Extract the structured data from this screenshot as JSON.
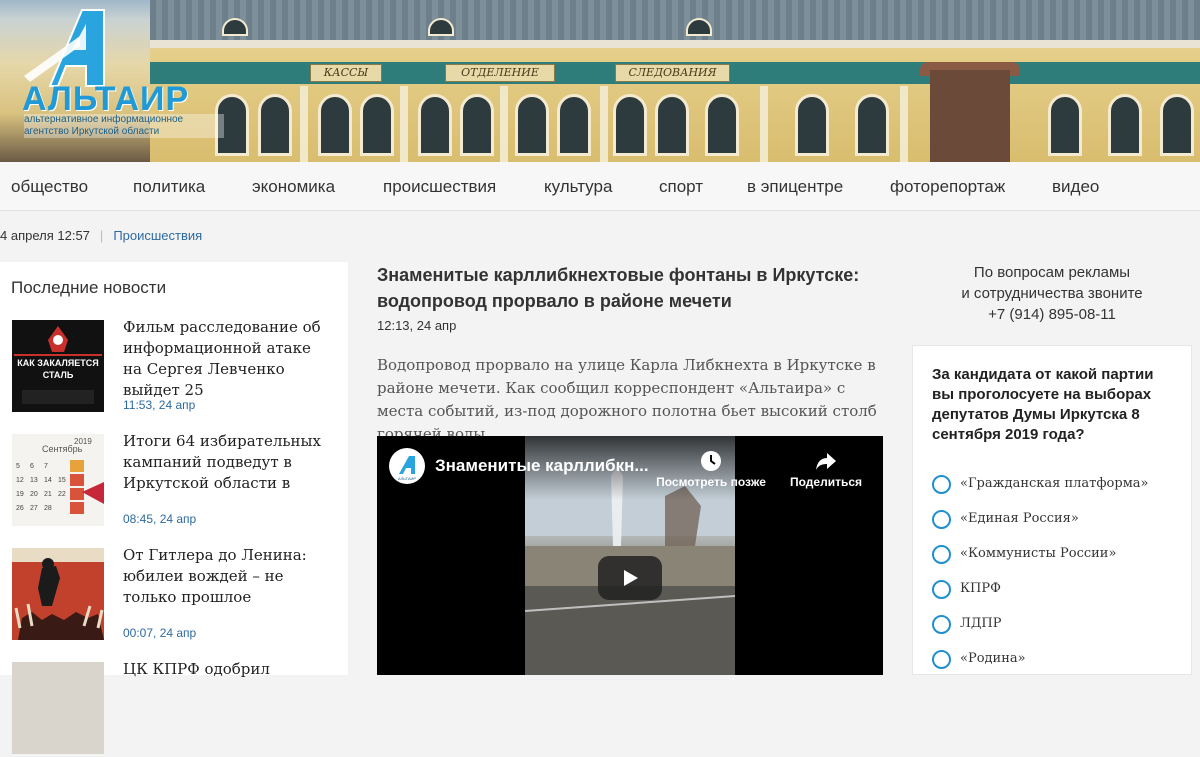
{
  "logo": {
    "word": "АЛЬТАИР",
    "subtitle_line1": "альтернативное информационное",
    "subtitle_line2": "агентство Иркутской области",
    "building_signs": [
      "КАССЫ",
      "ОТДЕЛЕНИЕ",
      "СЛЕДОВАНИЯ"
    ]
  },
  "nav": {
    "items": [
      "общество",
      "политика",
      "экономика",
      "происшествия",
      "культура",
      "спорт",
      "в эпицентре",
      "фоторепортаж",
      "видео"
    ]
  },
  "meta": {
    "date": "4 апреля 12:57",
    "category": "Происшествия"
  },
  "sidebar": {
    "title": "Последние новости",
    "items": [
      {
        "title": "Фильм расследование об информационной атаке на Сергея Левченко выйдет 25",
        "time": "11:53, 24 апр",
        "thumb_text": "КАК ЗАКАЛЯЕТСЯ СТАЛЬ"
      },
      {
        "title": "Итоги 64 избирательных кампаний подведут в Иркутской области в",
        "time": "08:45, 24 апр",
        "thumb_text": "2019 Сентябрь"
      },
      {
        "title": "От Гитлера до Ленина: юбилеи вождей – не только прошлое",
        "time": "00:07, 24 апр",
        "thumb_text": ""
      },
      {
        "title": "ЦК КПРФ одобрил",
        "time": "",
        "thumb_text": ""
      }
    ]
  },
  "article": {
    "headline": "Знаменитые карллибкнехтовые фонтаны в Иркутске: водопровод прорвало в районе мечети",
    "time": "12:13, 24 апр",
    "lead": "Водопровод прорвало на улице Карла Либкнехта в Иркутске в районе мечети. Как сообщил корреспондент «Альтаира» с места событий, из-под дорожного полотна бьет высокий столб горячей воды."
  },
  "video": {
    "title": "Знаменитые карллибкн...",
    "watch_later": "Посмотреть позже",
    "share": "Поделиться",
    "channel_logo_text": "АЛЬТАИР"
  },
  "ad": {
    "line1": "По вопросам рекламы",
    "line2": "и сотрудничества звоните",
    "phone": "+7 (914) 895-08-11"
  },
  "poll": {
    "question": "За кандидата от какой партии вы проголосуете на выборах депутатов Думы Иркутска 8 сентября 2019 года?",
    "options": [
      "«Гражданская платформа»",
      "«Единая Россия»",
      "«Коммунисты России»",
      "КПРФ",
      "ЛДПР",
      "«Родина»"
    ]
  },
  "colors": {
    "accent_blue": "#2d6aa0",
    "radio_blue": "#1f8fd0",
    "logo_blue": "#1f9ad6"
  }
}
